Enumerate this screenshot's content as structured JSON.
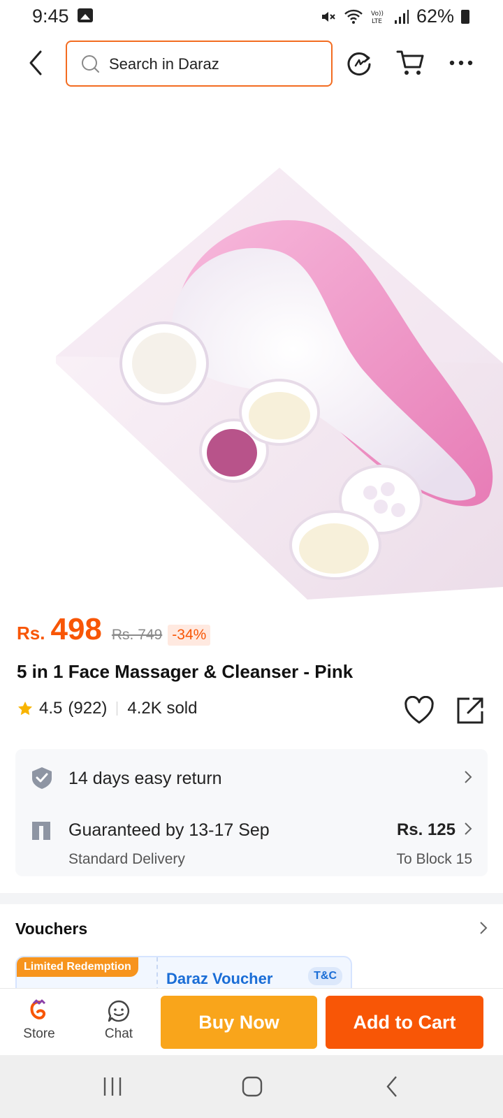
{
  "status_bar": {
    "time": "9:45",
    "battery": "62%",
    "icons": [
      "image-icon",
      "mute-icon",
      "wifi-icon",
      "volte-icon",
      "signal-icon",
      "battery-icon"
    ]
  },
  "header": {
    "search_placeholder": "Search in Daraz",
    "icons": [
      "back-icon",
      "search-icon",
      "refresh-icon",
      "cart-icon",
      "more-icon"
    ]
  },
  "product": {
    "image_description": "product-photo",
    "currency": "Rs.",
    "price": "498",
    "original_price": "Rs. 749",
    "discount": "-34%",
    "title": "5 in 1 Face Massager & Cleanser - Pink",
    "rating": "4.5",
    "rating_count": "(922)",
    "sold": "4.2K sold"
  },
  "services": {
    "return": {
      "label": "14 days easy return"
    },
    "delivery": {
      "label": "Guaranteed by 13-17 Sep",
      "sub": "Standard Delivery",
      "price": "Rs. 125",
      "location": "To Block 15"
    }
  },
  "vouchers": {
    "title": "Vouchers",
    "card": {
      "tag": "Limited Redemption",
      "name": "Daraz Voucher",
      "tc": "T&C"
    }
  },
  "action_bar": {
    "store_label": "Store",
    "chat_label": "Chat",
    "buy_now": "Buy Now",
    "add_to_cart": "Add to Cart"
  },
  "colors": {
    "brand_orange": "#f85606",
    "buy_now": "#f9a51b",
    "voucher_blue": "#1a6dd6",
    "rating_star": "#f8b400"
  }
}
